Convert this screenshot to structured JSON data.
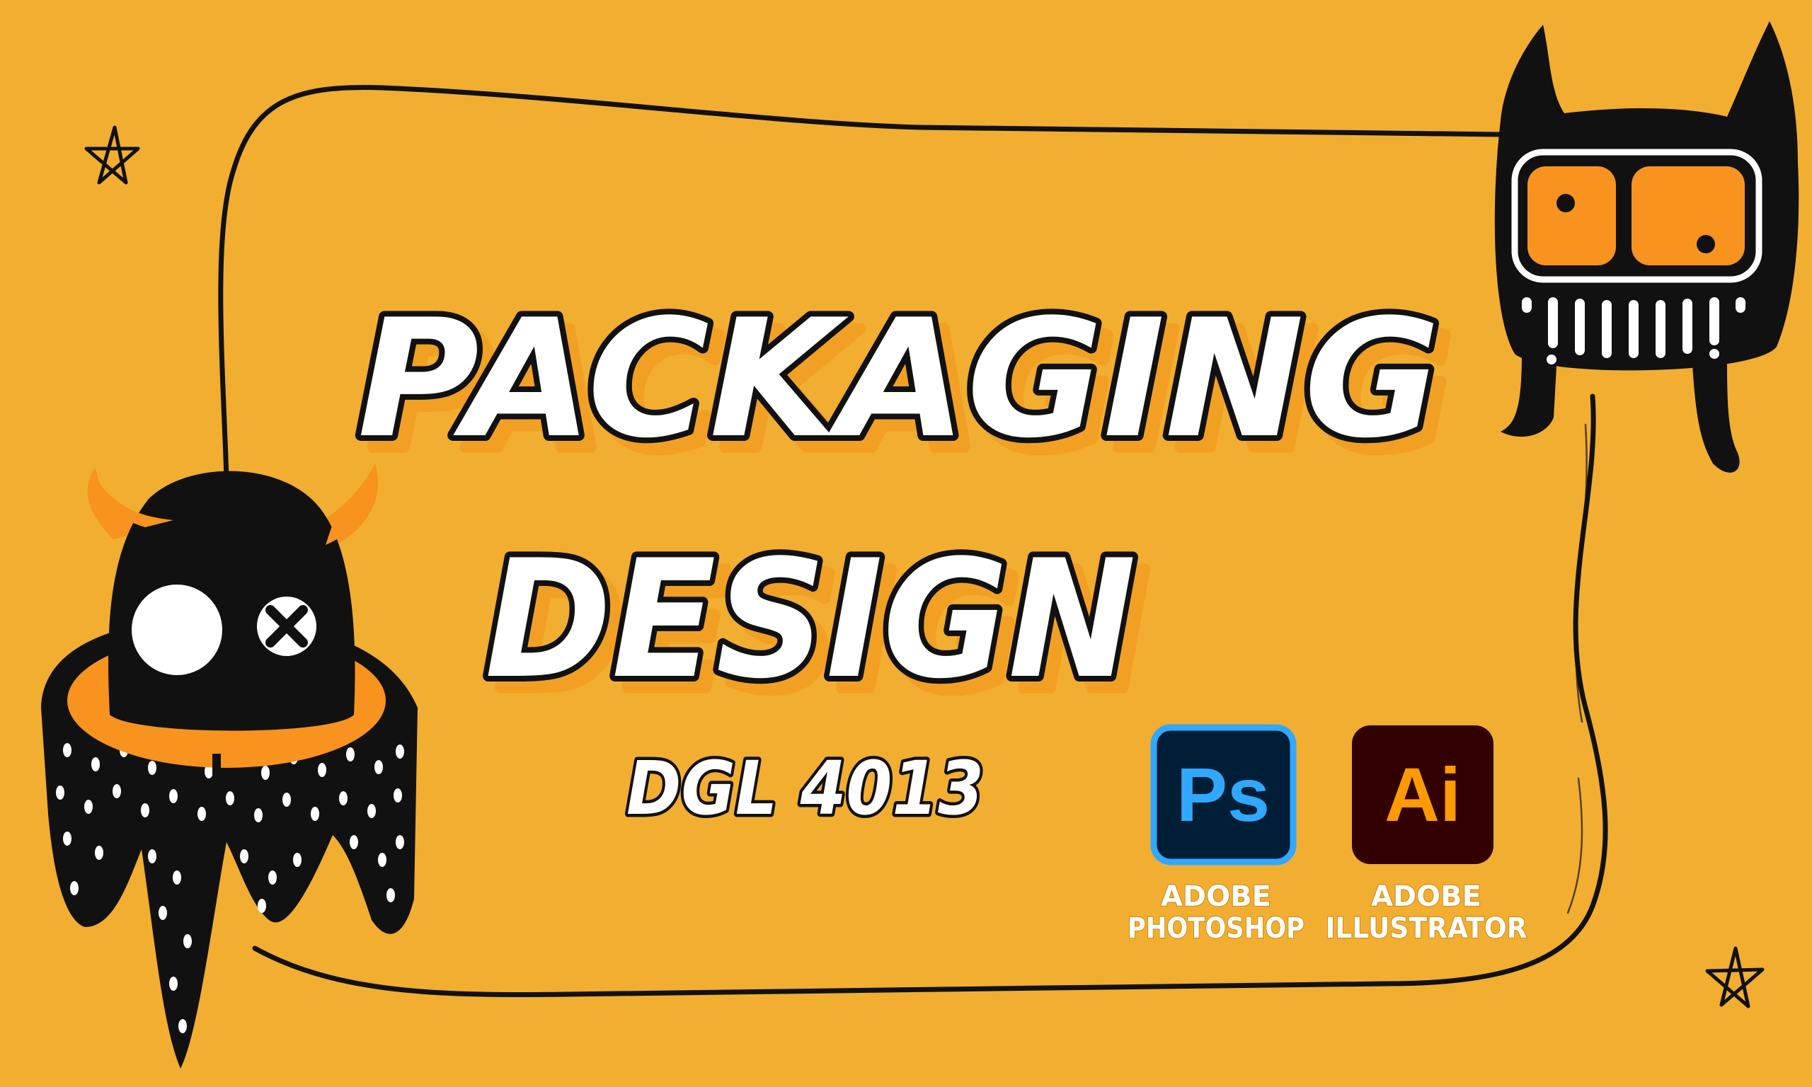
{
  "banner": {
    "title_line1": "PACKAGING",
    "title_line2": "DESIGN",
    "course_code": "DGL 4013"
  },
  "apps": [
    {
      "icon": "photoshop-icon",
      "letters": "Ps",
      "name_line1": "ADOBE",
      "name_line2": "PHOTOSHOP",
      "bg": "#001E36",
      "fg": "#31A8FF"
    },
    {
      "icon": "illustrator-icon",
      "letters": "Ai",
      "name_line1": "ADOBE",
      "name_line2": "ILLUSTRATOR",
      "bg": "#330000",
      "fg": "#FF9A00"
    }
  ],
  "colors": {
    "background": "#F2AE30",
    "accent_orange": "#F7931E",
    "ink": "#111111"
  }
}
